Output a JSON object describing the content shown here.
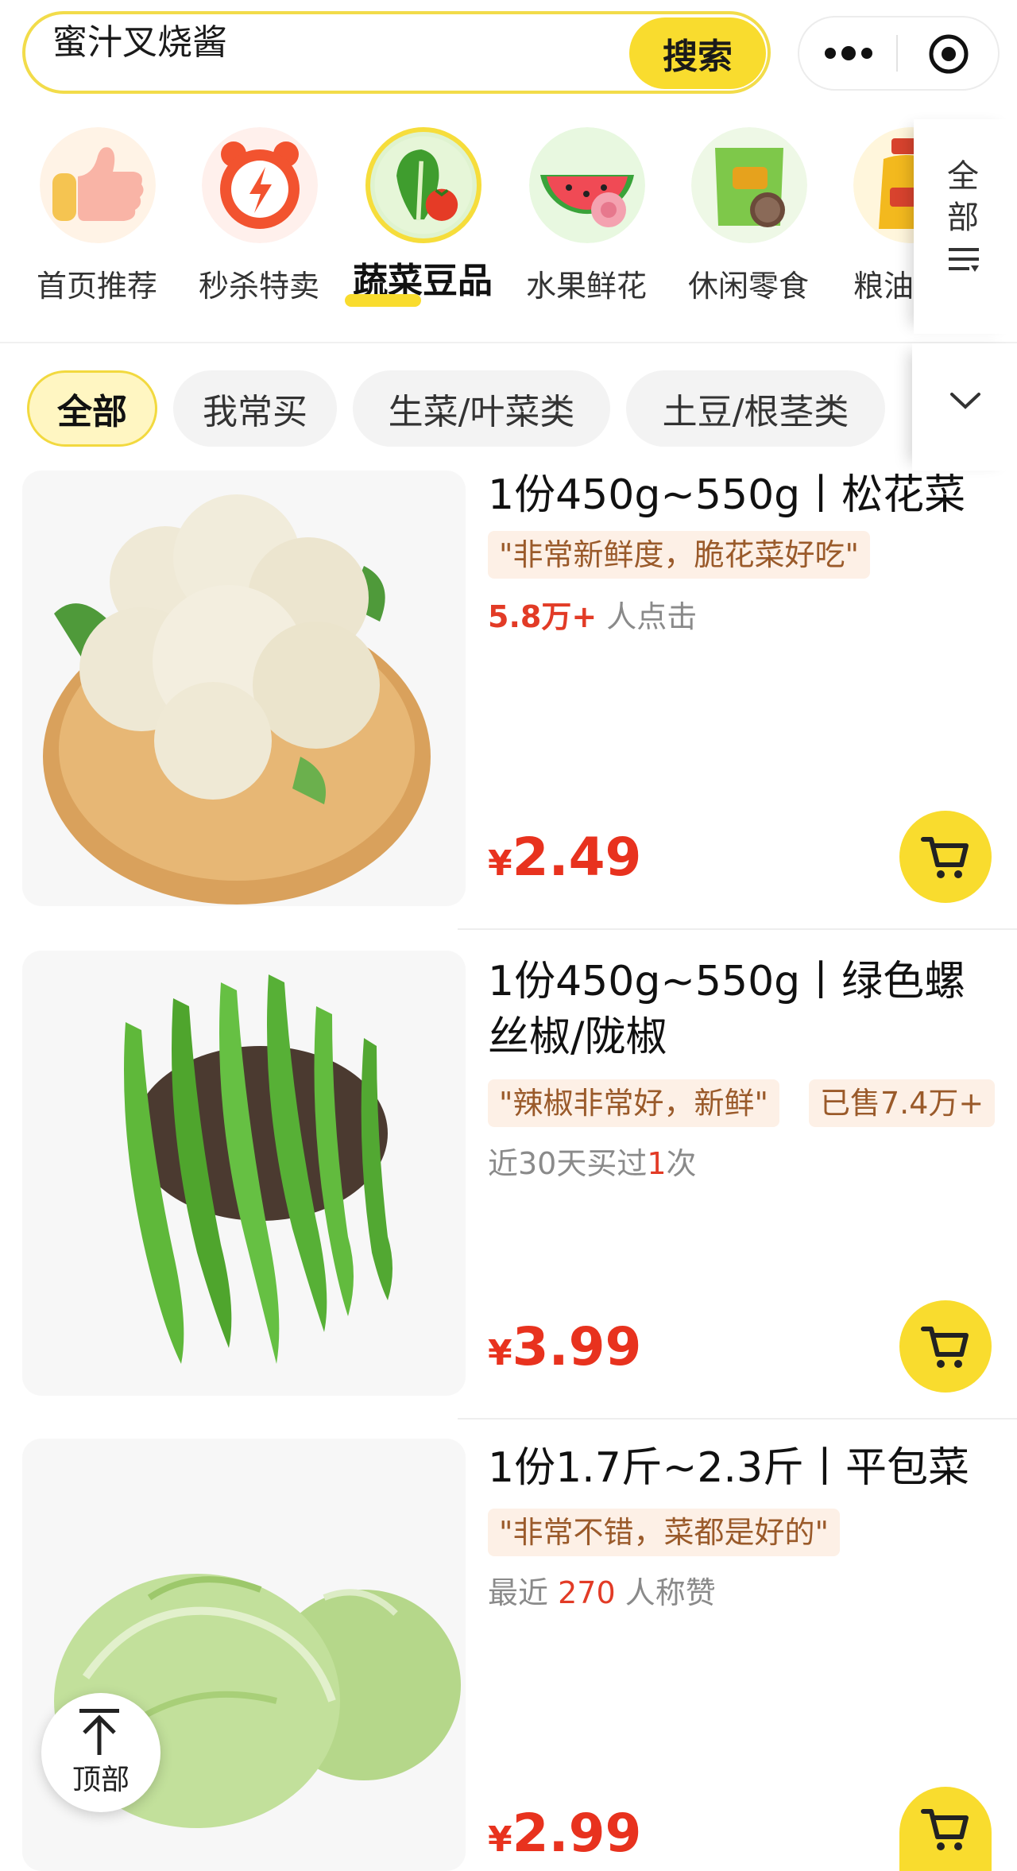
{
  "search": {
    "query": "蜜汁叉烧酱",
    "button_label": "搜索"
  },
  "capsule": {
    "more_icon": "more-dots-icon",
    "close_icon": "target-circle-icon"
  },
  "categories": [
    {
      "label": "首页推荐",
      "icon": "thumbs-up-icon",
      "active": false
    },
    {
      "label": "秒杀特卖",
      "icon": "lightning-clock-icon",
      "active": false
    },
    {
      "label": "蔬菜豆品",
      "icon": "vegetable-icon",
      "active": true
    },
    {
      "label": "水果鲜花",
      "icon": "watermelon-rose-icon",
      "active": false
    },
    {
      "label": "休闲零食",
      "icon": "snack-bag-icon",
      "active": false
    },
    {
      "label": "粮油",
      "icon": "oil-bottle-icon",
      "active": false
    }
  ],
  "category_all": {
    "label": "全部",
    "icon": "list-filter-icon"
  },
  "filters": {
    "chips": [
      "全部",
      "我常买",
      "生菜/叶菜类",
      "土豆/根茎类"
    ],
    "active_index": 0,
    "expand_icon": "chevron-down-icon"
  },
  "products": [
    {
      "title": "1份450g~550g丨松花菜",
      "image": "cauliflower",
      "review": "\"非常新鲜度，脆花菜好吃\"",
      "meta_highlight": "5.8万+",
      "meta_text": " 人点击",
      "price_symbol": "¥",
      "price": "2.49"
    },
    {
      "title": "1份450g~550g丨绿色螺丝椒/陇椒",
      "image": "green-peppers",
      "review": "\"辣椒非常好，新鲜\"",
      "sold": "已售7.4万+",
      "meta_prefix": "近30天买过",
      "meta_highlight": "1",
      "meta_suffix": "次",
      "price_symbol": "¥",
      "price": "3.99"
    },
    {
      "title": "1份1.7斤~2.3斤丨平包菜",
      "image": "cabbage",
      "review": "\"非常不错，菜都是好的\"",
      "meta_prefix": "最近 ",
      "meta_highlight": "270",
      "meta_suffix": " 人称赞",
      "price_symbol": "¥",
      "price": "2.99"
    }
  ],
  "back_to_top": {
    "label": "顶部",
    "icon": "arrow-up-icon"
  },
  "colors": {
    "accent_yellow": "#f9dc2e",
    "price_red": "#e8321e",
    "tag_bg": "#fdf0e6",
    "tag_text": "#9a5a2a"
  }
}
